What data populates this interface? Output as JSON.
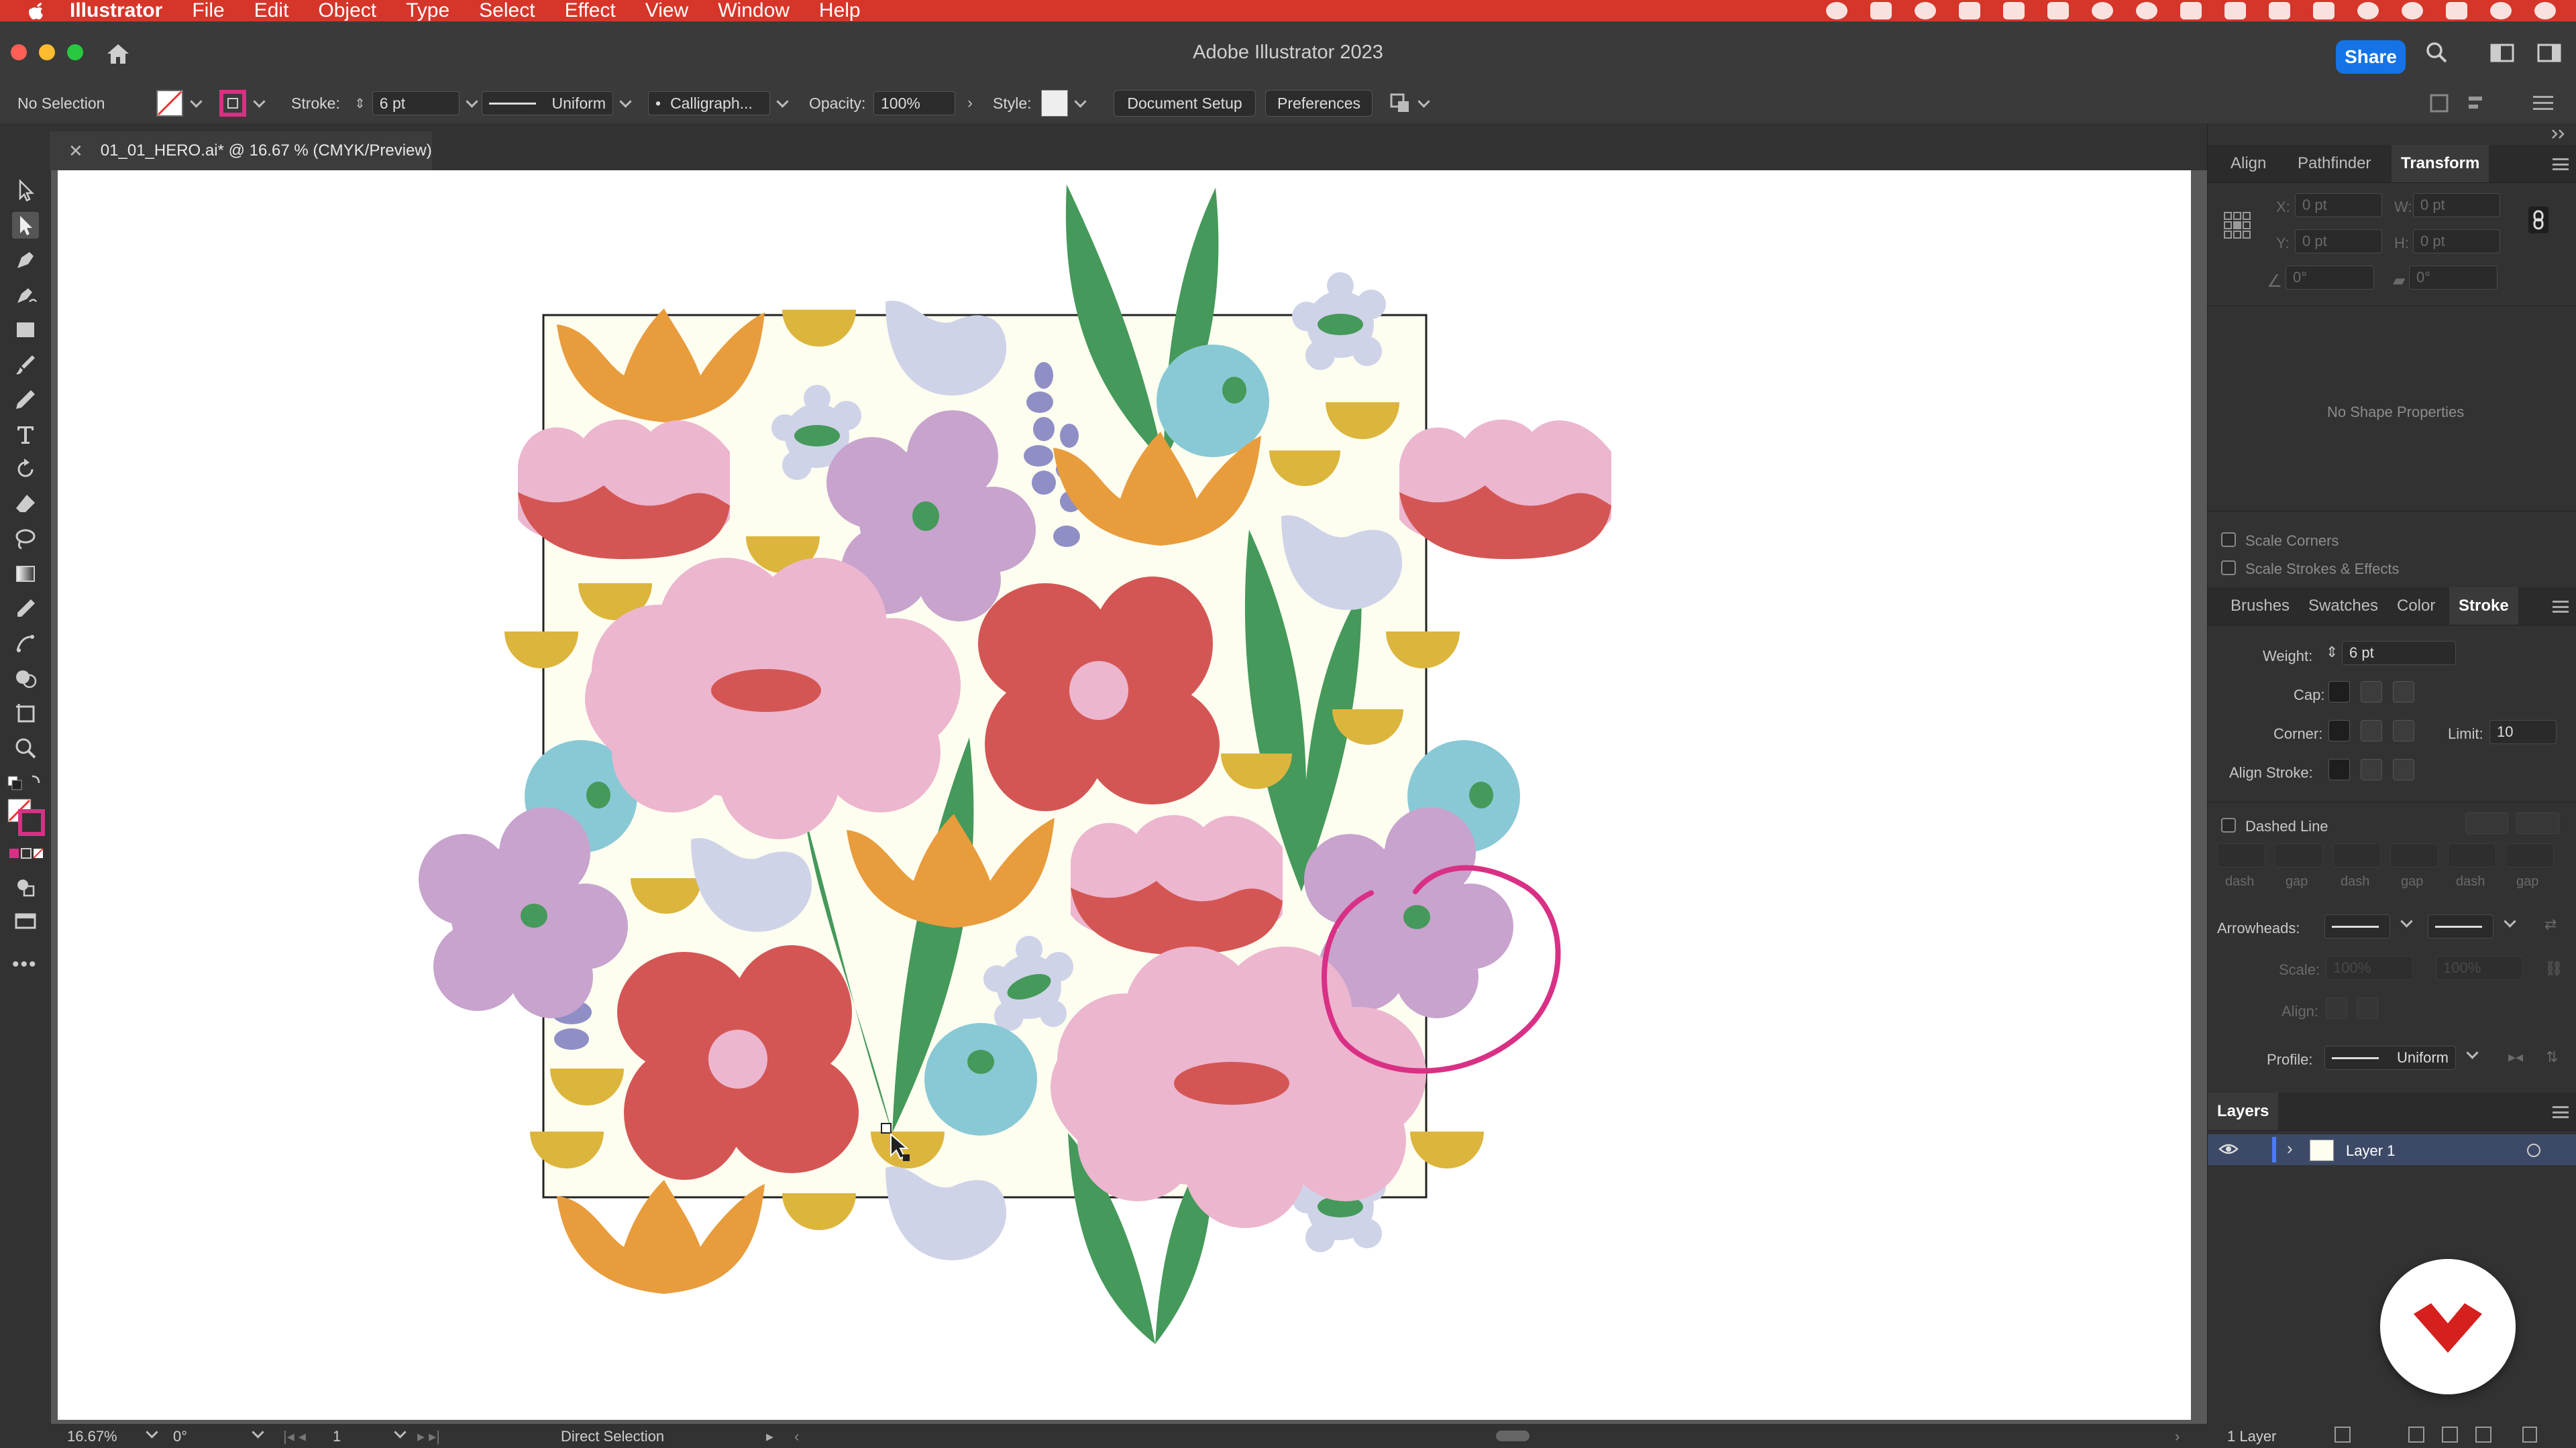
{
  "menubar": {
    "app_name": "Illustrator",
    "items": [
      "File",
      "Edit",
      "Object",
      "Type",
      "Select",
      "Effect",
      "View",
      "Window",
      "Help"
    ]
  },
  "titlebar": {
    "window_title": "Adobe Illustrator 2023",
    "share_label": "Share"
  },
  "controlbar": {
    "selection": "No Selection",
    "stroke_label": "Stroke:",
    "stroke_value": "6 pt",
    "profile": "Uniform",
    "brush": "Calligraph...",
    "opacity_label": "Opacity:",
    "opacity_value": "100%",
    "style_label": "Style:",
    "doc_setup_label": "Document Setup",
    "preferences_label": "Preferences"
  },
  "document_tab": {
    "title": "01_01_HERO.ai* @ 16.67 % (CMYK/Preview)"
  },
  "transform_panel": {
    "tabs": [
      "Align",
      "Pathfinder",
      "Transform"
    ],
    "x_label": "X:",
    "y_label": "Y:",
    "w_label": "W:",
    "h_label": "H:",
    "x_value": "0 pt",
    "y_value": "0 pt",
    "w_value": "0 pt",
    "h_value": "0 pt",
    "angle_value": "0°",
    "shear_value": "0°",
    "no_shape": "No Shape Properties",
    "scale_corners": "Scale Corners",
    "scale_strokes": "Scale Strokes & Effects"
  },
  "stroke_panel": {
    "tabs": [
      "Brushes",
      "Swatches",
      "Color",
      "Stroke"
    ],
    "weight_label": "Weight:",
    "weight_value": "6 pt",
    "cap_label": "Cap:",
    "corner_label": "Corner:",
    "limit_label": "Limit:",
    "limit_value": "10",
    "align_label": "Align Stroke:",
    "dashed_label": "Dashed Line",
    "dash_labels": [
      "dash",
      "gap",
      "dash",
      "gap",
      "dash",
      "gap"
    ],
    "arrowheads_label": "Arrowheads:",
    "scale_label": "Scale:",
    "scale_value_1": "100%",
    "scale_value_2": "100%",
    "align_arrow_label": "Align:",
    "profile_label": "Profile:",
    "profile_value": "Uniform"
  },
  "layers_panel": {
    "title": "Layers",
    "layers": [
      {
        "name": "Layer 1"
      }
    ],
    "count": "1 Layer"
  },
  "statusbar": {
    "zoom": "16.67%",
    "rotation": "0°",
    "artboard": "1",
    "tool": "Direct Selection"
  },
  "colors": {
    "menubar": "#d6352a",
    "accent_blue": "#1473e6",
    "annotation_magenta": "#d93085",
    "artboard_fill": "#fdfdf0",
    "orange": "#e89c3c",
    "pink": "#ecb6cf",
    "red": "#d45654",
    "lavender": "#c7a3cd",
    "light_lavender": "#cfd3e8",
    "teal": "#89c9d6",
    "green": "#45995a",
    "yellow": "#dcb53c",
    "purple": "#8f8fc6"
  },
  "icons": [
    "apple-icon",
    "home-icon",
    "search-icon",
    "fill-swatch-icon",
    "stroke-swatch-icon",
    "selection-tool-icon",
    "direct-selection-tool-icon",
    "pen-tool-icon",
    "curvature-tool-icon",
    "rectangle-tool-icon",
    "paintbrush-tool-icon",
    "pencil-tool-icon",
    "type-tool-icon",
    "rotate-tool-icon",
    "eraser-tool-icon",
    "lasso-tool-icon",
    "gradient-tool-icon",
    "eyedropper-tool-icon",
    "puppet-warp-icon",
    "shape-builder-icon",
    "artboard-tool-icon",
    "zoom-tool-icon",
    "eye-icon",
    "link-icon",
    "brand-logo-icon"
  ]
}
